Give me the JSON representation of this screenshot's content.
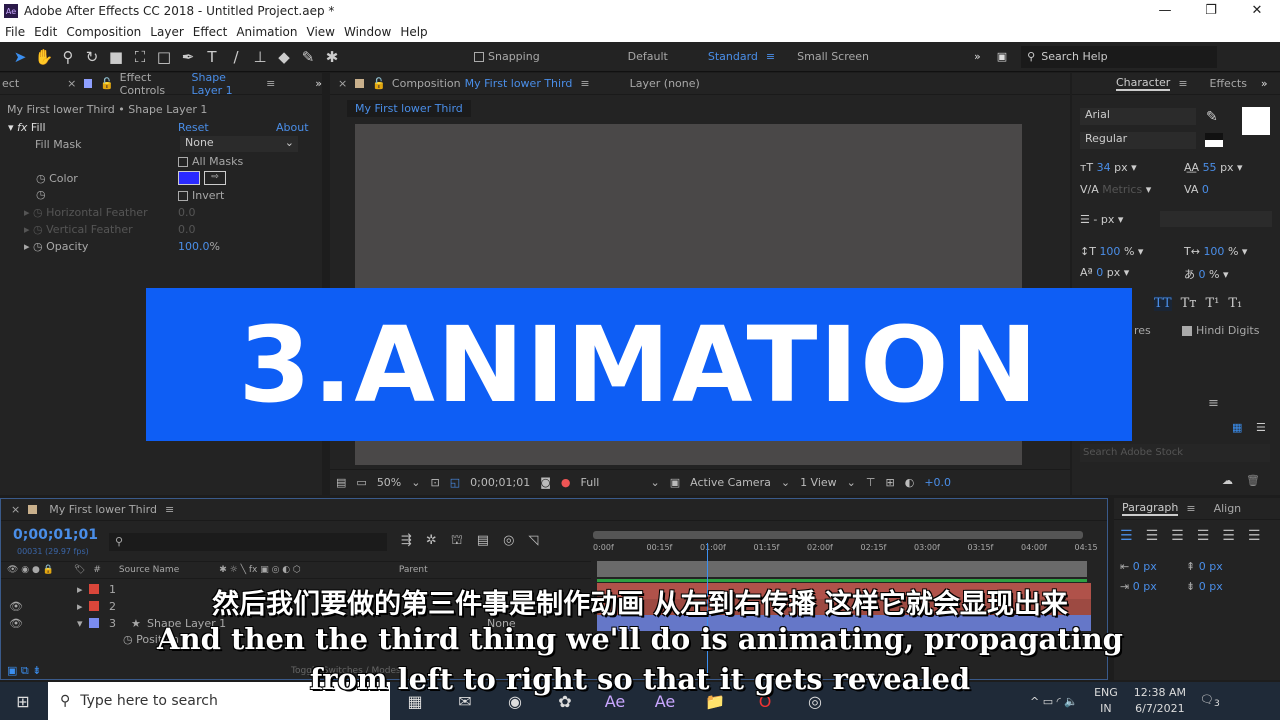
{
  "window": {
    "title": "Adobe After Effects CC 2018 - Untitled Project.aep *",
    "app_icon": "Ae",
    "minimize": "—",
    "maximize": "❐",
    "close": "✕"
  },
  "menu": [
    "File",
    "Edit",
    "Composition",
    "Layer",
    "Effect",
    "Animation",
    "View",
    "Window",
    "Help"
  ],
  "toolbar": {
    "snapping": "Snapping",
    "workspaces": [
      "Default",
      "Standard",
      "Small Screen"
    ],
    "active_workspace": "Standard",
    "search_help": "Search Help"
  },
  "effect_controls": {
    "prev_tab": "ect",
    "tab_label": "Effect Controls",
    "layer": "Shape Layer 1",
    "breadcrumb": "My First lower Third • Shape Layer 1",
    "effect": "Fill",
    "reset": "Reset",
    "about": "About",
    "fill_mask_label": "Fill Mask",
    "fill_mask_value": "None",
    "all_masks": "All Masks",
    "color_label": "Color",
    "color_value": "#2a2aff",
    "invert": "Invert",
    "h_feather": "Horizontal Feather",
    "h_feather_val": "0.0",
    "v_feather": "Vertical Feather",
    "v_feather_val": "0.0",
    "opacity": "Opacity",
    "opacity_val": "100.0",
    "opacity_unit": "%"
  },
  "composition": {
    "tab_label": "Composition",
    "comp_name": "My First lower Third",
    "layer_tab": "Layer (none)",
    "sub_tab": "My First lower Third",
    "zoom": "50%",
    "timecode": "0;00;01;01",
    "resolution": "Full",
    "camera": "Active Camera",
    "views": "1 View",
    "exposure": "+0.0"
  },
  "banner_text": "3.ANIMATION",
  "banner_color": "#0e5ef5",
  "character": {
    "tab": "Character",
    "other_tab": "Effects",
    "font": "Arial",
    "style": "Regular",
    "size": "34",
    "size_unit": "px",
    "leading": "55",
    "leading_unit": "px",
    "kerning": "Metrics",
    "tracking": "0",
    "stroke": "- px",
    "vscale": "100",
    "vscale_unit": "%",
    "hscale": "100",
    "hscale_unit": "%",
    "baseline": "0",
    "baseline_unit": "px",
    "tsume": "0",
    "tsume_unit": "%",
    "styles": [
      "TT",
      "Tт",
      "T¹",
      "T₁"
    ],
    "ligatures_partial": "res",
    "hindi_digits": "Hindi Digits",
    "stock_search": "Search Adobe Stock"
  },
  "timeline": {
    "comp_name": "My First lower Third",
    "timecode": "0;00;01;01",
    "frames": "00031 (29.97 fps)",
    "columns": {
      "source": "Source Name",
      "parent": "Parent"
    },
    "ruler": [
      "0:00f",
      "00:15f",
      "01:00f",
      "01:15f",
      "02:00f",
      "02:15f",
      "03:00f",
      "03:15f",
      "04:00f",
      "04:15"
    ],
    "layers": [
      {
        "num": "1",
        "color": "#d9463a"
      },
      {
        "num": "2",
        "color": "#d9463a"
      },
      {
        "num": "3",
        "name": "Shape Layer 1",
        "color": "#7a8cf0",
        "parent": "None"
      }
    ],
    "property": "Position",
    "toggle": "Toggle Switches / Modes"
  },
  "paragraph": {
    "tab": "Paragraph",
    "other_tab": "Align",
    "indent_values": [
      "0 px",
      "0 px",
      "0 px",
      "0 px"
    ]
  },
  "subtitles": {
    "zh": "然后我们要做的第三件事是制作动画 从左到右传播 这样它就会显现出来",
    "en1": "And then the third thing we'll do is animating, propagating",
    "en2": "from left to right so that it gets revealed"
  },
  "taskbar": {
    "search_placeholder": "Type here to search",
    "lang1": "ENG",
    "lang2": "IN",
    "time": "12:38 AM",
    "date": "6/7/2021",
    "notifications": "3"
  }
}
